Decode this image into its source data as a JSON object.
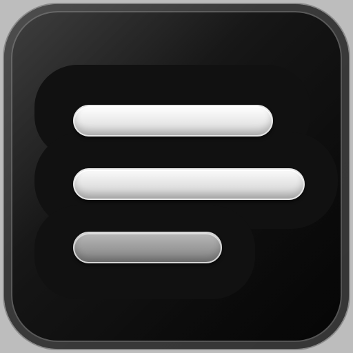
{
  "app_icon": {
    "icon_name": "menu-lines-icon",
    "colors": {
      "tile_dark": "#050505",
      "tile_light": "#2b2b2b",
      "bar_light": "#ffffff",
      "bar_dim": "#9a9a9a",
      "blob": "#111111"
    }
  }
}
